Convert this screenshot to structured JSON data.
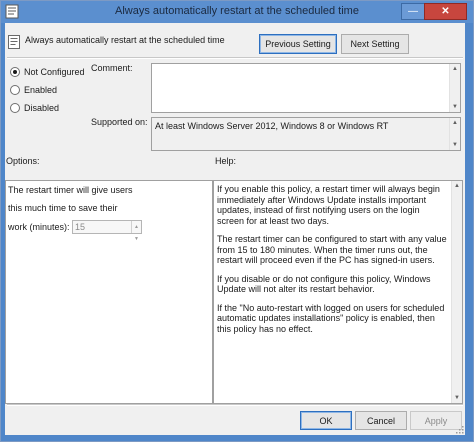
{
  "window": {
    "title": "Always automatically restart at the scheduled time",
    "minimize_symbol": "—",
    "close_symbol": "✕"
  },
  "header": {
    "policy_name": "Always automatically restart at the scheduled time",
    "previous_label": "Previous Setting",
    "next_label": "Next Setting"
  },
  "state": {
    "options": [
      {
        "label": "Not Configured",
        "selected": true
      },
      {
        "label": "Enabled",
        "selected": false
      },
      {
        "label": "Disabled",
        "selected": false
      }
    ]
  },
  "comment": {
    "label": "Comment:",
    "value": ""
  },
  "supported": {
    "label": "Supported on:",
    "value": "At least Windows Server 2012, Windows 8 or Windows RT"
  },
  "options_pane": {
    "heading": "Options:",
    "line1": "The restart timer will give users",
    "line2": "this much time to save their",
    "line3": "work (minutes):",
    "minutes_value": "15"
  },
  "help_pane": {
    "heading": "Help:",
    "paragraphs": [
      "If you enable this policy, a restart timer will always begin immediately after Windows Update installs important updates, instead of first notifying users on the login screen for at least two days.",
      "The restart timer can be configured to start with any value from 15 to 180 minutes. When the timer runs out, the restart will proceed even if the PC has signed-in users.",
      "If you disable or do not configure this policy, Windows Update will not alter its restart behavior.",
      "If the \"No auto-restart with logged on users for scheduled automatic updates installations\" policy is enabled, then this policy has no effect."
    ]
  },
  "footer": {
    "ok_label": "OK",
    "cancel_label": "Cancel",
    "apply_label": "Apply"
  },
  "colors": {
    "title_bar": "#5b8fcf",
    "close_button": "#c7463e",
    "dialog_background": "#f0f0f0"
  }
}
